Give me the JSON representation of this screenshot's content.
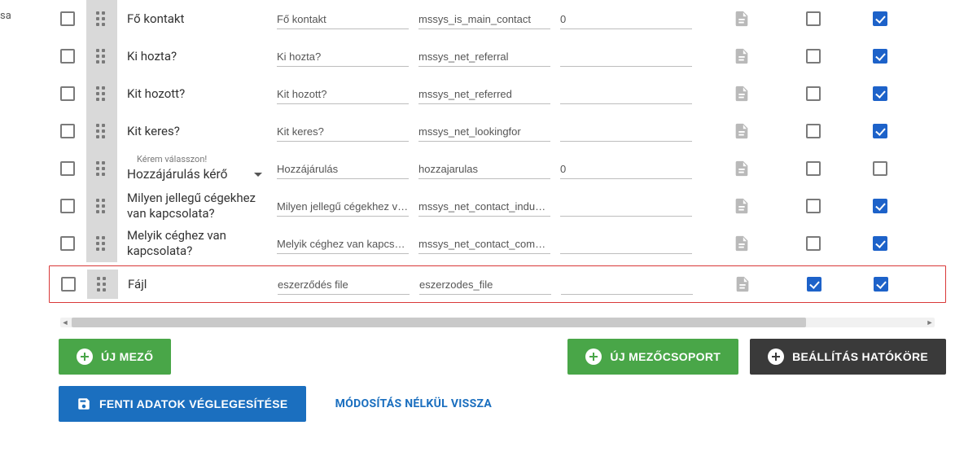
{
  "sidebar_fragment": "sa",
  "rows": [
    {
      "label": "Fő kontakt",
      "f1": "Fő kontakt",
      "f2": "mssys_is_main_contact",
      "f3": "0",
      "c1": false,
      "c2": true,
      "kind": "plain"
    },
    {
      "label": "Ki hozta?",
      "f1": "Ki hozta?",
      "f2": "mssys_net_referral",
      "f3": "",
      "c1": false,
      "c2": true,
      "kind": "plain"
    },
    {
      "label": "Kit hozott?",
      "f1": "Kit hozott?",
      "f2": "mssys_net_referred",
      "f3": "",
      "c1": false,
      "c2": true,
      "kind": "plain"
    },
    {
      "label": "Kit keres?",
      "f1": "Kit keres?",
      "f2": "mssys_net_lookingfor",
      "f3": "",
      "c1": false,
      "c2": true,
      "kind": "plain"
    },
    {
      "label": "Hozzájárulás kérő",
      "f1": "Hozzájárulás",
      "f2": "hozzajarulas",
      "f3": "0",
      "c1": false,
      "c2": false,
      "kind": "dropdown",
      "hint": "Kérem válasszon!"
    },
    {
      "label": "Milyen jellegű cégekhez van kapcsolata?",
      "f1": "Milyen jellegű cégekhez van",
      "f2": "mssys_net_contact_industry",
      "f3": "",
      "c1": false,
      "c2": true,
      "kind": "plain"
    },
    {
      "label": "Melyik céghez van kapcsolata?",
      "f1": "Melyik céghez van kapcsolat",
      "f2": "mssys_net_contact_compan",
      "f3": "",
      "c1": false,
      "c2": true,
      "kind": "plain"
    },
    {
      "label": "Fájl",
      "f1": "eszerződés file",
      "f2": "eszerzodes_file",
      "f3": "",
      "c1": true,
      "c2": true,
      "kind": "plain",
      "highlight": true
    }
  ],
  "buttons": {
    "new_field": "ÚJ MEZŐ",
    "new_group": "ÚJ MEZŐCSOPORT",
    "scope": "BEÁLLÍTÁS HATÓKÖRE",
    "finalize": "FENTI ADATOK VÉGLEGESÍTÉSE",
    "back": "MÓDOSÍTÁS NÉLKÜL VISSZA"
  }
}
